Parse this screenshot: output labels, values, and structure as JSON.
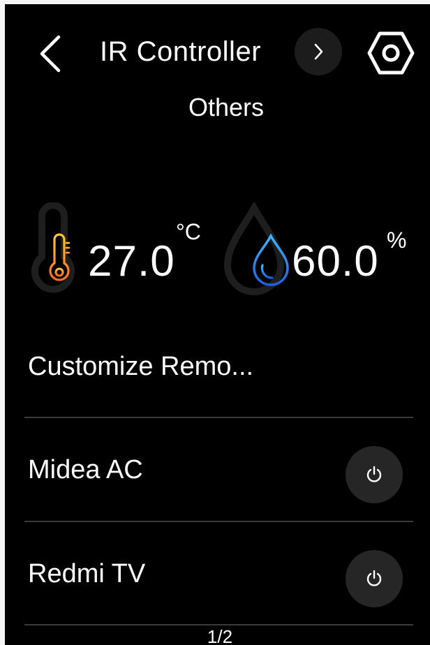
{
  "header": {
    "title": "IR Controller",
    "subtitle": "Others"
  },
  "icons": {
    "back": "chevron-left-icon",
    "next": "chevron-right-icon",
    "settings": "hexagon-gear-icon",
    "temperature": "thermometer-icon",
    "humidity": "water-drop-icon",
    "power": "power-icon"
  },
  "sensors": {
    "temperature": {
      "value": "27.0",
      "unit": "°C"
    },
    "humidity": {
      "value": "60.0",
      "unit": "%"
    }
  },
  "list": {
    "customize_label": "Customize Remo...",
    "devices": [
      {
        "name": "Midea AC"
      },
      {
        "name": "Redmi TV"
      }
    ]
  },
  "pager": {
    "text": "1/2"
  },
  "colors": {
    "background": "#000000",
    "thermo_gradient_top": "#ffc933",
    "thermo_gradient_bottom": "#ff6a2a",
    "drop_gradient_top": "#3fb6ff",
    "drop_gradient_bottom": "#1f5fe0"
  }
}
